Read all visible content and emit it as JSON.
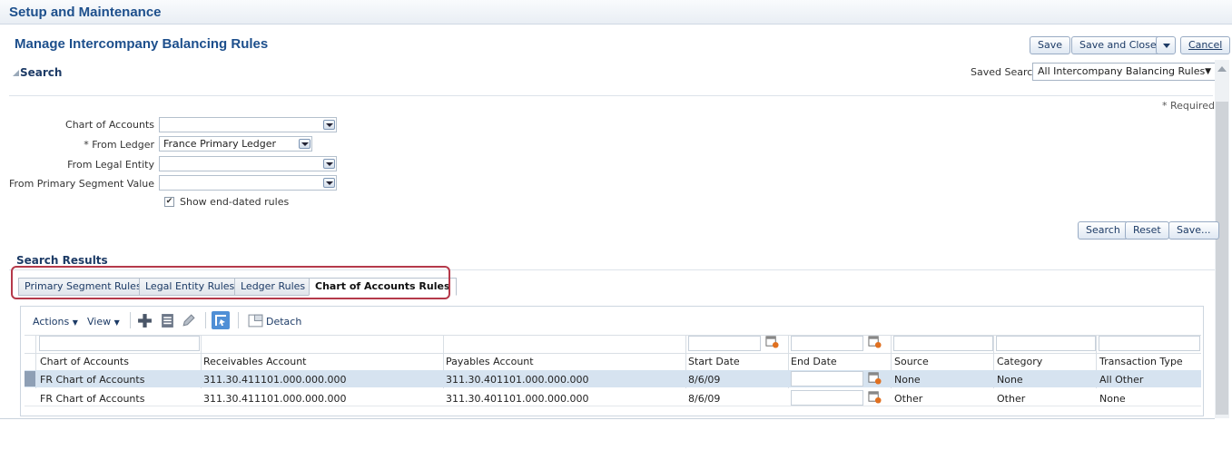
{
  "app": {
    "title": "Setup and Maintenance"
  },
  "page": {
    "title": "Manage Intercompany Balancing Rules"
  },
  "actions": {
    "save": "Save",
    "save_close": "Save and Close",
    "cancel": "Cancel"
  },
  "search": {
    "header": "Search",
    "saved_label": "Saved Search",
    "saved_value": "All Intercompany Balancing Rules",
    "required_note": "* Required",
    "fields": {
      "coa_label": "Chart of Accounts",
      "coa_value": "",
      "ledger_label": "* From Ledger",
      "ledger_value": "France Primary Ledger",
      "entity_label": "From Legal Entity",
      "entity_value": "",
      "segment_label": "From Primary Segment Value",
      "segment_value": ""
    },
    "show_end_dated": "Show end-dated rules",
    "show_end_dated_checked": true,
    "buttons": {
      "search": "Search",
      "reset": "Reset",
      "save": "Save..."
    }
  },
  "results": {
    "header": "Search Results",
    "tabs": [
      "Primary Segment Rules",
      "Legal Entity Rules",
      "Ledger Rules",
      "Chart of Accounts Rules"
    ],
    "active_tab": "Chart of Accounts Rules",
    "toolbar": {
      "actions": "Actions",
      "view": "View",
      "detach": "Detach"
    },
    "columns": [
      "Chart of Accounts",
      "Receivables Account",
      "Payables Account",
      "Start Date",
      "End Date",
      "Source",
      "Category",
      "Transaction Type"
    ],
    "rows": [
      [
        "FR Chart of Accounts",
        "311.30.411101.000.000.000",
        "311.30.401101.000.000.000",
        "8/6/09",
        "",
        "None",
        "None",
        "All Other"
      ],
      [
        "FR Chart of Accounts",
        "311.30.411101.000.000.000",
        "311.30.401101.000.000.000",
        "8/6/09",
        "",
        "Other",
        "Other",
        "None"
      ]
    ]
  },
  "colors": {
    "brand": "#1d4f8c",
    "highlight_border": "#b5394a",
    "selected_row": "#d6e3f0"
  }
}
